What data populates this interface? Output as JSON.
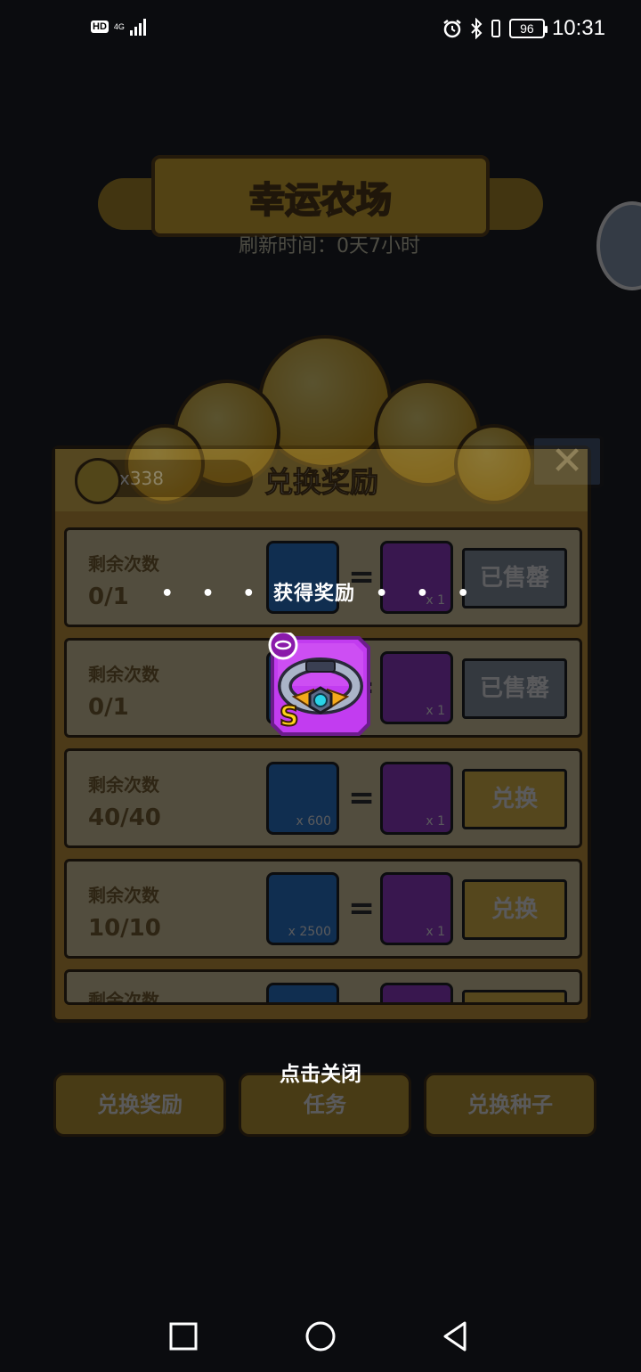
{
  "status_bar": {
    "hd": "HD",
    "network": "4G",
    "battery": "96",
    "time": "10:31"
  },
  "background": {
    "banner_title": "幸运农场",
    "subtitle": "刷新时间：0天7小时"
  },
  "exchange_panel": {
    "title": "兑换奖励",
    "coin_count": "x338",
    "rows": [
      {
        "label": "剩余次数",
        "count": "0/1",
        "cost": "",
        "reward_qty": "x 1",
        "button": "已售罄",
        "state": "sold"
      },
      {
        "label": "剩余次数",
        "count": "0/1",
        "cost": "",
        "reward_qty": "x 1",
        "button": "已售罄",
        "state": "sold"
      },
      {
        "label": "剩余次数",
        "count": "40/40",
        "cost": "x 600",
        "reward_qty": "x 1",
        "button": "兑换",
        "state": "ok"
      },
      {
        "label": "剩余次数",
        "count": "10/10",
        "cost": "x 2500",
        "reward_qty": "x 1",
        "button": "兑换",
        "state": "ok"
      },
      {
        "label": "剩余次数",
        "count": "",
        "cost": "",
        "reward_qty": "",
        "button": "",
        "state": "ok"
      }
    ]
  },
  "bottom_buttons": [
    "兑换奖励",
    "任务",
    "兑换种子"
  ],
  "reward_popup": {
    "dots_left": "• • •",
    "title": "获得奖励",
    "dots_right": "• • •",
    "item_icon": "s-rank-collar-icon",
    "item_grade": "S",
    "tap_to_close": "点击关闭"
  },
  "nav_bar": {
    "recent_icon": "square-icon",
    "home_icon": "circle-icon",
    "back_icon": "triangle-back-icon"
  },
  "colors": {
    "item_purple": "#c23cf0",
    "grade_gold": "#ffd21a",
    "panel_gold": "#d59c2b"
  }
}
